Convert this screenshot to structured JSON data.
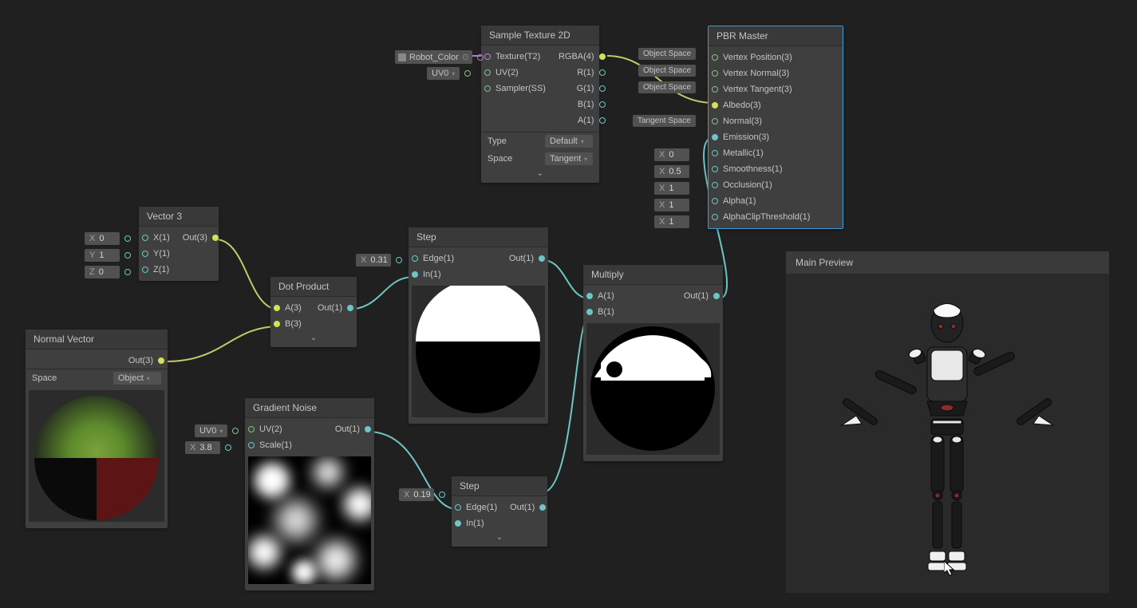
{
  "nodes": {
    "sample_texture": {
      "title": "Sample Texture 2D",
      "inputs": [
        "Texture(T2)",
        "UV(2)",
        "Sampler(SS)"
      ],
      "outputs": [
        "RGBA(4)",
        "R(1)",
        "G(1)",
        "B(1)",
        "A(1)"
      ],
      "type_label": "Type",
      "type_value": "Default",
      "space_label": "Space",
      "space_value": "Tangent",
      "texture_slot": "Robot_Color",
      "uv_slot": "UV0"
    },
    "pbr_master": {
      "title": "PBR Master",
      "inputs": [
        {
          "label": "Vertex Position(3)",
          "pill": "Object Space"
        },
        {
          "label": "Vertex Normal(3)",
          "pill": "Object Space"
        },
        {
          "label": "Vertex Tangent(3)",
          "pill": "Object Space"
        },
        {
          "label": "Albedo(3)"
        },
        {
          "label": "Normal(3)",
          "pill": "Tangent Space"
        },
        {
          "label": "Emission(3)"
        },
        {
          "label": "Metallic(1)",
          "xval": "0"
        },
        {
          "label": "Smoothness(1)",
          "xval": "0.5"
        },
        {
          "label": "Occlusion(1)",
          "xval": "1"
        },
        {
          "label": "Alpha(1)",
          "xval": "1"
        },
        {
          "label": "AlphaClipThreshold(1)",
          "xval": "1"
        }
      ]
    },
    "vector3": {
      "title": "Vector 3",
      "inputs": [
        "X(1)",
        "Y(1)",
        "Z(1)"
      ],
      "output": "Out(3)",
      "x": "0",
      "y": "1",
      "z": "0"
    },
    "dot_product": {
      "title": "Dot Product",
      "inputs": [
        "A(3)",
        "B(3)"
      ],
      "output": "Out(1)"
    },
    "normal_vector": {
      "title": "Normal Vector",
      "output": "Out(3)",
      "space_label": "Space",
      "space_value": "Object"
    },
    "step1": {
      "title": "Step",
      "inputs": [
        "Edge(1)",
        "In(1)"
      ],
      "output": "Out(1)",
      "edge_x": "0.31"
    },
    "step2": {
      "title": "Step",
      "inputs": [
        "Edge(1)",
        "In(1)"
      ],
      "output": "Out(1)",
      "edge_x": "0.19"
    },
    "gradient_noise": {
      "title": "Gradient Noise",
      "inputs": [
        "UV(2)",
        "Scale(1)"
      ],
      "output": "Out(1)",
      "uv_slot": "UV0",
      "scale_x": "3.8"
    },
    "multiply": {
      "title": "Multiply",
      "inputs": [
        "A(1)",
        "B(1)"
      ],
      "output": "Out(1)"
    }
  },
  "main_preview": {
    "title": "Main Preview"
  },
  "field_prefix": {
    "x": "X",
    "y": "Y",
    "z": "Z"
  }
}
